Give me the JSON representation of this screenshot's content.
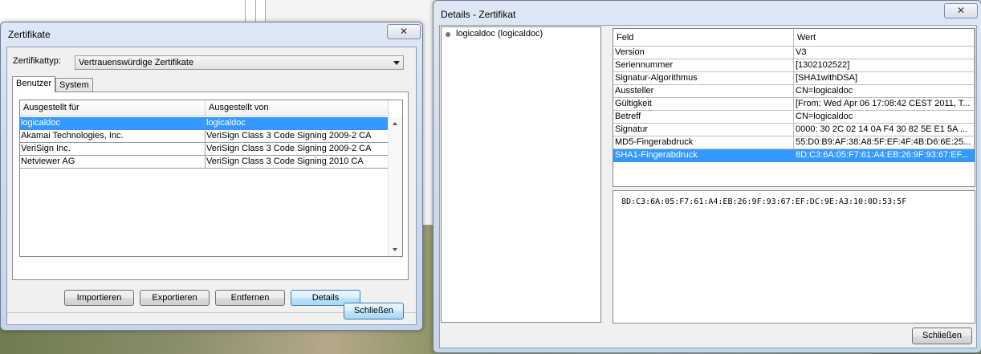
{
  "left_dialog": {
    "title": "Zertifikate",
    "type_label": "Zertifikattyp:",
    "type_value": "Vertrauenswürdige Zertifikate",
    "tabs": [
      "Benutzer",
      "System"
    ],
    "columns": [
      "Ausgestellt für",
      "Ausgestellt von"
    ],
    "rows": [
      {
        "for": "logicaldoc",
        "by": "logicaldoc"
      },
      {
        "for": "Akamai Technologies, Inc.",
        "by": "VeriSign Class 3 Code Signing 2009-2 CA"
      },
      {
        "for": "VeriSign Inc.",
        "by": "VeriSign Class 3 Code Signing 2009-2 CA"
      },
      {
        "for": "Netviewer AG",
        "by": "VeriSign Class 3 Code Signing 2010 CA"
      }
    ],
    "selected_row": 0,
    "buttons": {
      "import": "Importieren",
      "export": "Exportieren",
      "remove": "Entfernen",
      "details": "Details",
      "close": "Schließen"
    }
  },
  "right_dialog": {
    "title": "Details - Zertifikat",
    "tree_item": "logicaldoc (logicaldoc)",
    "columns": [
      "Feld",
      "Wert"
    ],
    "rows": [
      {
        "field": "Version",
        "value": "V3"
      },
      {
        "field": "Seriennummer",
        "value": "[1302102522]"
      },
      {
        "field": "Signatur-Algorithmus",
        "value": "[SHA1withDSA]"
      },
      {
        "field": "Aussteller",
        "value": "CN=logicaldoc"
      },
      {
        "field": "Gültigkeit",
        "value": "[From: Wed Apr 06 17:08:42 CEST 2011, T..."
      },
      {
        "field": "Betreff",
        "value": "CN=logicaldoc"
      },
      {
        "field": "Signatur",
        "value": "0000: 30 2C 02 14 0A F4 30 82  5E E1 5A ..."
      },
      {
        "field": "MD5-Fingerabdruck",
        "value": "55:D0:B9:AF:38:A8:5F:EF:4F:4B:D6:6E:25..."
      },
      {
        "field": "SHA1-Fingerabdruck",
        "value": "8D:C3:6A:05:F7:61:A4:EB:26:9F:93:67:EF..."
      }
    ],
    "selected_row": 8,
    "value_detail": "8D:C3:6A:05:F7:61:A4:EB:26:9F:93:67:EF:DC:9E:A3:10:0D:53:5F",
    "close_button": "Schließen"
  }
}
